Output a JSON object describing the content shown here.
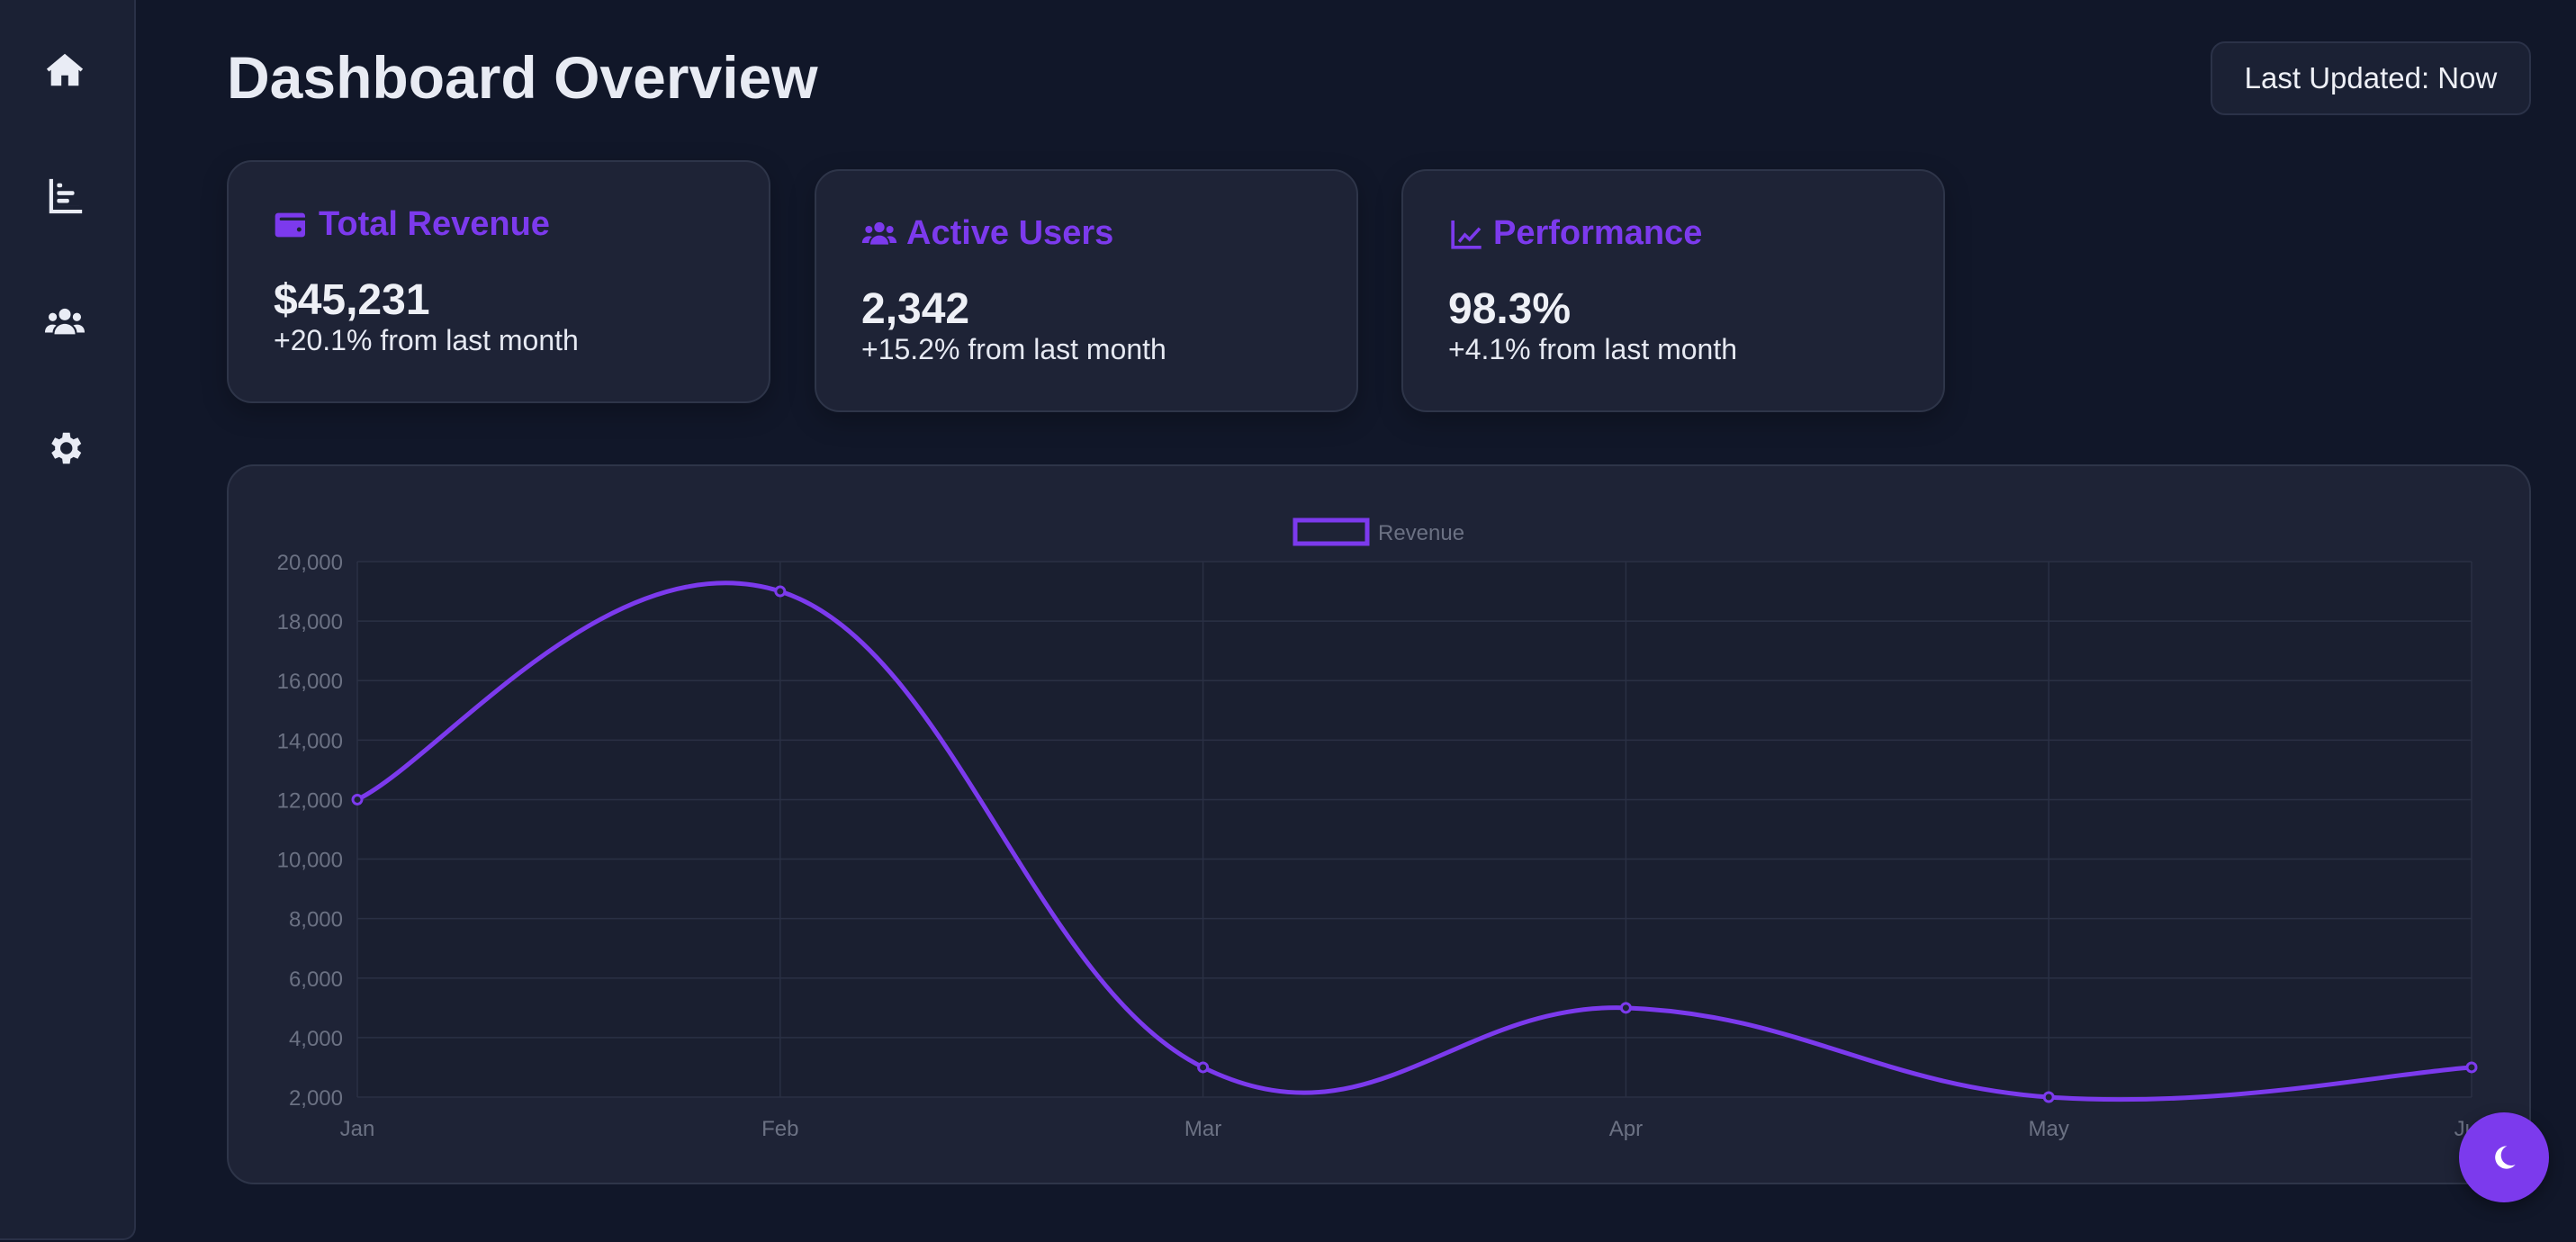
{
  "sidebar": {
    "items": [
      {
        "icon": "home-icon"
      },
      {
        "icon": "chart-bar-icon"
      },
      {
        "icon": "users-icon"
      },
      {
        "icon": "gear-icon"
      }
    ]
  },
  "header": {
    "title": "Dashboard Overview",
    "last_updated": "Last Updated: Now"
  },
  "cards": [
    {
      "icon": "wallet-icon",
      "title": "Total Revenue",
      "value": "$45,231",
      "change": "+20.1% from last month"
    },
    {
      "icon": "users-icon",
      "title": "Active Users",
      "value": "2,342",
      "change": "+15.2% from last month"
    },
    {
      "icon": "chart-line-icon",
      "title": "Performance",
      "value": "98.3%",
      "change": "+4.1% from last month"
    }
  ],
  "colors": {
    "accent": "#7c3aed",
    "background": "#111729",
    "panel": "#1e2336",
    "grid": "#2a3044",
    "tick_text": "#6b7183"
  },
  "chart_data": {
    "type": "line",
    "categories": [
      "Jan",
      "Feb",
      "Mar",
      "Apr",
      "May",
      "Jun"
    ],
    "series": [
      {
        "name": "Revenue",
        "values": [
          12000,
          19000,
          3000,
          5000,
          2000,
          3000
        ]
      }
    ],
    "ylim": [
      2000,
      20000
    ],
    "yticks": [
      "20,000",
      "18,000",
      "16,000",
      "14,000",
      "12,000",
      "10,000",
      "8,000",
      "6,000",
      "4,000",
      "2,000"
    ],
    "legend": "top-center",
    "grid": true,
    "curve": "smooth"
  },
  "fab": {
    "icon": "moon-icon"
  }
}
